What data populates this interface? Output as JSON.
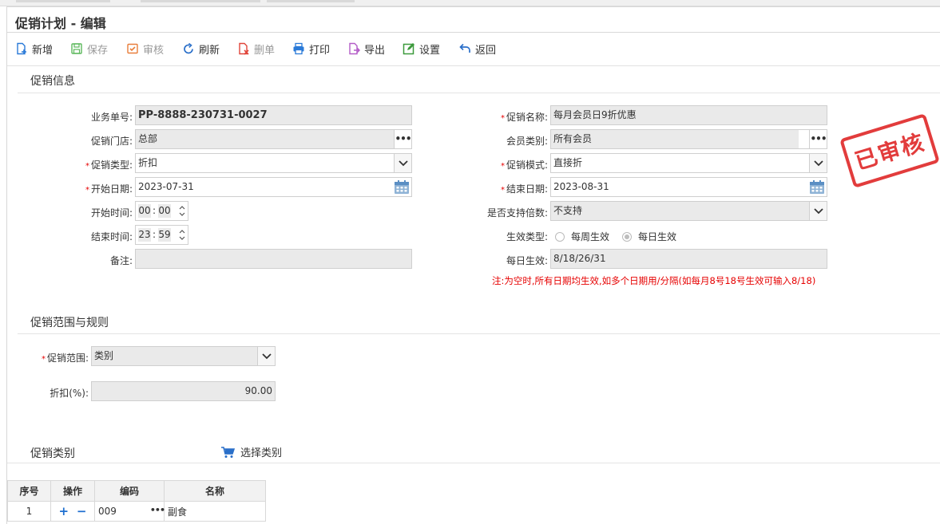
{
  "page": {
    "title": "促销计划 - 编辑"
  },
  "toolbar": [
    {
      "label": "新增",
      "icon": "add-doc-icon",
      "color": "#2a7ad8",
      "disabled": false
    },
    {
      "label": "保存",
      "icon": "save-icon",
      "color": "#5cb85c",
      "disabled": true
    },
    {
      "label": "审核",
      "icon": "audit-icon",
      "color": "#e87e3a",
      "disabled": true
    },
    {
      "label": "刷新",
      "icon": "refresh-icon",
      "color": "#2a6fc9",
      "disabled": false
    },
    {
      "label": "删单",
      "icon": "delete-doc-icon",
      "color": "#e0453a",
      "disabled": true
    },
    {
      "label": "打印",
      "icon": "print-icon",
      "color": "#2a7ad8",
      "disabled": false
    },
    {
      "label": "导出",
      "icon": "export-icon",
      "color": "#b45dc8",
      "disabled": false
    },
    {
      "label": "设置",
      "icon": "settings-edit-icon",
      "color": "#3c9a3c",
      "disabled": false
    },
    {
      "label": "返回",
      "icon": "back-arrow-icon",
      "color": "#2a6fc9",
      "disabled": false
    }
  ],
  "promo_info": {
    "section_title": "促销信息",
    "doc_no_label": "业务单号:",
    "doc_no": "PP-8888-230731-0027",
    "store_label": "促销门店:",
    "store": "总部",
    "type_label": "促销类型:",
    "type": "折扣",
    "start_date_label": "开始日期:",
    "start_date": "2023-07-31",
    "start_time_label": "开始时间:",
    "start_time_h": "00",
    "start_time_m": "00",
    "end_time_label": "结束时间:",
    "end_time_h": "23",
    "end_time_m": "59",
    "remark_label": "备注:",
    "remark": "",
    "name_label": "促销名称:",
    "name": "每月会员日9折优惠",
    "member_label": "会员类别:",
    "member": "所有会员",
    "mode_label": "促销模式:",
    "mode": "直接折",
    "end_date_label": "结束日期:",
    "end_date": "2023-08-31",
    "multiple_label": "是否支持倍数:",
    "multiple": "不支持",
    "effect_type_label": "生效类型:",
    "effect_weekly": "每周生效",
    "effect_daily": "每日生效",
    "effect_selected": "每日生效",
    "daily_label": "每日生效:",
    "daily": "8/18/26/31",
    "note": "注:为空时,所有日期均生效,如多个日期用/分隔(如每月8号18号生效可输入8/18)"
  },
  "stamp": {
    "text": "已审核",
    "color": "#e23c3c"
  },
  "scope": {
    "section_title": "促销范围与规则",
    "range_label": "促销范围:",
    "range": "类别",
    "discount_label": "折扣(%):",
    "discount": "90.00"
  },
  "category": {
    "section_title": "促销类别",
    "select_label": "选择类别",
    "columns": [
      "序号",
      "操作",
      "编码",
      "名称"
    ],
    "rows": [
      {
        "index": "1",
        "code": "009",
        "name": "副食"
      }
    ]
  }
}
